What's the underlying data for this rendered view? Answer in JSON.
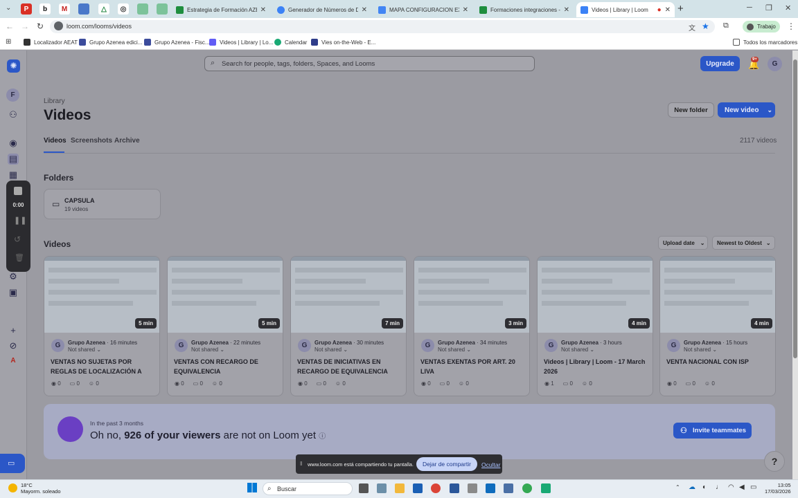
{
  "browser": {
    "tabs": [
      {
        "title": "Estrategia de Formación AZENE",
        "color": "#1e8e3e",
        "active": false
      },
      {
        "title": "Generador de Números de DNI",
        "color": "#3b82f6",
        "active": false
      },
      {
        "title": "MAPA CONFIGURACION EXCEL",
        "color": "#4285f4",
        "active": false
      },
      {
        "title": "Formaciones integraciones - He",
        "color": "#1e8e3e",
        "active": false
      },
      {
        "title": "Videos | Library | Loom",
        "color": "#625df5",
        "active": true
      }
    ],
    "url": "loom.com/looms/videos",
    "profile_label": "Trabajo",
    "bookmarks": [
      "Localizador AEAT",
      "Grupo Azenea edici...",
      "Grupo Azenea - Fisc...",
      "Videos | Library | Lo...",
      "Calendar",
      "Vies on-the-Web - E..."
    ],
    "all_bookmarks": "Todos los marcadores"
  },
  "header": {
    "search_placeholder": "Search for people, tags, folders, Spaces, and Looms",
    "upgrade": "Upgrade",
    "notif_badge": "9+",
    "avatar": "G"
  },
  "sidebar": {
    "workspace_letter": "F",
    "timer": "0:00",
    "bottom_letter": "A"
  },
  "library": {
    "breadcrumb": "Library",
    "title": "Videos",
    "new_folder": "New folder",
    "new_video": "New video",
    "tabs": [
      "Videos",
      "Screenshots",
      "Archive"
    ],
    "count": "2117 videos",
    "folders_heading": "Folders",
    "folder": {
      "name": "CAPSULA",
      "count": "19 videos"
    },
    "videos_heading": "Videos",
    "sort_upload": "Upload date",
    "sort_order": "Newest to Oldest"
  },
  "videos": [
    {
      "duration": "5 min",
      "author": "Grupo Azenea",
      "time": "16 minutes",
      "share": "Not shared",
      "title": "VENTAS NO SUJETAS POR REGLAS DE LOCALIZACIÓN A CLIENTE...",
      "views": "0",
      "comments": "0",
      "reactions": "0"
    },
    {
      "duration": "5 min",
      "author": "Grupo Azenea",
      "time": "22 minutes",
      "share": "Not shared",
      "title": "VENTAS CON RECARGO DE EQUIVALENCIA",
      "views": "0",
      "comments": "0",
      "reactions": "0"
    },
    {
      "duration": "7 min",
      "author": "Grupo Azenea",
      "time": "30 minutes",
      "share": "Not shared",
      "title": "VENTAS DE INICIATIVAS EN RECARGO DE EQUIVALENCIA",
      "views": "0",
      "comments": "0",
      "reactions": "0"
    },
    {
      "duration": "3 min",
      "author": "Grupo Azenea",
      "time": "34 minutes",
      "share": "Not shared",
      "title": "VENTAS EXENTAS POR ART. 20 LIVA",
      "views": "0",
      "comments": "0",
      "reactions": "0"
    },
    {
      "duration": "4 min",
      "author": "Grupo Azenea",
      "time": "3 hours",
      "share": "Not shared",
      "title": "Videos | Library | Loom - 17 March 2026",
      "views": "1",
      "comments": "0",
      "reactions": "0"
    },
    {
      "duration": "4 min",
      "author": "Grupo Azenea",
      "time": "15 hours",
      "share": "Not shared",
      "title": "VENTA NACIONAL CON ISP",
      "views": "0",
      "comments": "0",
      "reactions": "0"
    }
  ],
  "banner": {
    "sub": "In the past 3 months",
    "pre": "Oh no, ",
    "bold": "926 of your viewers",
    "post": " are not on Loom yet",
    "invite": "Invite teammates"
  },
  "sharebar": {
    "text": "www.loom.com está compartiendo tu pantalla.",
    "stop": "Dejar de compartir",
    "hide": "Ocultar"
  },
  "taskbar": {
    "temp": "18°C",
    "weather": "Mayorm. soleado",
    "search": "Buscar",
    "time": "13:05",
    "date": "17/03/2026"
  }
}
